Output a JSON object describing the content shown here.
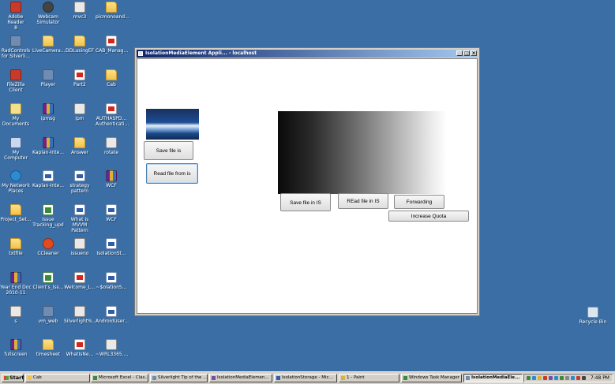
{
  "desktop": {
    "icons": [
      {
        "label": "Adobe Reader\n8",
        "icon": "adobe-reader-icon"
      },
      {
        "label": "Webcam\nSimulator",
        "icon": "webcam-icon"
      },
      {
        "label": "mvc3",
        "icon": "document-icon"
      },
      {
        "label": "picmonoand...",
        "icon": "folder-icon"
      },
      {
        "label": "RadControls\nfor Silverli...",
        "icon": "radcontrols-icon"
      },
      {
        "label": "LiveCamera...",
        "icon": "folder-icon"
      },
      {
        "label": "DDLusingEF",
        "icon": "folder-icon"
      },
      {
        "label": "CAB_Manag...",
        "icon": "pdf-icon"
      },
      {
        "label": "FileZilla Client",
        "icon": "filezilla-icon"
      },
      {
        "label": "Player",
        "icon": "player-icon"
      },
      {
        "label": "Part2",
        "icon": "pdf-icon"
      },
      {
        "label": "Cab",
        "icon": "folder-icon"
      },
      {
        "label": "My Documents",
        "icon": "my-documents-icon"
      },
      {
        "label": "ipmsg",
        "icon": "ipmsg-icon"
      },
      {
        "label": "ipm",
        "icon": "document-icon"
      },
      {
        "label": "AUTHASPD...\nAuthenticati...",
        "icon": "pdf-icon"
      },
      {
        "label": "My Computer",
        "icon": "my-computer-icon"
      },
      {
        "label": "Kaplan-Inte...",
        "icon": "winrar-icon"
      },
      {
        "label": "Answer",
        "icon": "folder-icon"
      },
      {
        "label": "rotate",
        "icon": "document-icon"
      },
      {
        "label": "My Network\nPlaces",
        "icon": "network-icon"
      },
      {
        "label": "Kaplan-Inte...",
        "icon": "word-doc-icon"
      },
      {
        "label": "strategy\npattern",
        "icon": "word-doc-icon"
      },
      {
        "label": "WCF",
        "icon": "winrar-icon"
      },
      {
        "label": "Project_Set...",
        "icon": "folder-icon"
      },
      {
        "label": "Issue\nTracking_upd",
        "icon": "excel-icon"
      },
      {
        "label": "What is MVVM\nPattern",
        "icon": "word-doc-icon"
      },
      {
        "label": "WCF",
        "icon": "word-doc-icon"
      },
      {
        "label": "txtfile",
        "icon": "folder-icon"
      },
      {
        "label": "CCleaner",
        "icon": "ccleaner-icon"
      },
      {
        "label": "issueno",
        "icon": "document-icon"
      },
      {
        "label": "IsolationSt...",
        "icon": "word-doc-icon"
      },
      {
        "label": "Year End Doc\n2010-11",
        "icon": "winrar-icon"
      },
      {
        "label": "Client's_Iss...",
        "icon": "excel-icon"
      },
      {
        "label": "Welcome_L...",
        "icon": "pdf-icon"
      },
      {
        "label": "~$olationS...",
        "icon": "word-doc-icon"
      },
      {
        "label": "s",
        "icon": "document-icon"
      },
      {
        "label": "vm_web",
        "icon": "app-icon"
      },
      {
        "label": "Silverlight%...",
        "icon": "document-icon"
      },
      {
        "label": "AndroidUser...",
        "icon": "word-doc-icon"
      },
      {
        "label": "fullscreen",
        "icon": "winrar-icon"
      },
      {
        "label": "timesheet",
        "icon": "folder-icon"
      },
      {
        "label": "WhatIsNe...",
        "icon": "pdf-icon"
      },
      {
        "label": "~WRL3365....",
        "icon": "document-icon"
      }
    ],
    "recycle_bin": {
      "label": "Recycle Bin",
      "icon": "recycle-bin-icon"
    }
  },
  "window": {
    "title": "IsolationMediaElement Appli... - localhost",
    "controls": {
      "minimize": "_",
      "maximize": "□",
      "close": "×"
    },
    "buttons": {
      "save_file_is": "Save file is",
      "read_file_from_is": "Read file from is",
      "save_file_in_is": "Save file in IS",
      "read_file_in_is": "REad file in IS",
      "forwarding": "Forwarding",
      "increase_quota": "Increase Quota"
    }
  },
  "taskbar": {
    "start_label": "Start",
    "tasks": [
      {
        "label": "Cab",
        "active": false
      },
      {
        "label": "Microsoft Excel - Clas...",
        "active": false
      },
      {
        "label": "Silverlight Tip of the ...",
        "active": false
      },
      {
        "label": "IsolationMediaElemen...",
        "active": false
      },
      {
        "label": "IsolationStorage - Mic...",
        "active": false
      },
      {
        "label": "1 - Paint",
        "active": false
      },
      {
        "label": "Windows Task Manager",
        "active": false
      },
      {
        "label": "IsolationMediaEle...",
        "active": true
      }
    ],
    "clock": "7:48 PM"
  }
}
